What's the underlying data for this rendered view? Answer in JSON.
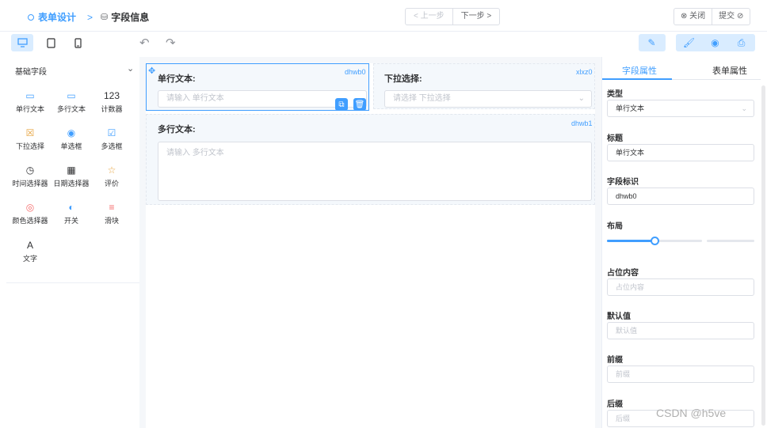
{
  "header": {
    "breadcrumb_1": "表单设计",
    "breadcrumb_sep": ">",
    "breadcrumb_2": "字段信息",
    "prev_label": "< 上一步",
    "next_label": "下一步 >",
    "close_label": "⊗ 关闭",
    "submit_label": "提交 ⊘"
  },
  "sidebar": {
    "title": "基础字段",
    "items": [
      {
        "label": "单行文本",
        "icon": "single-line-text-icon",
        "glyph": "▭"
      },
      {
        "label": "多行文本",
        "icon": "multi-line-text-icon",
        "glyph": "▭"
      },
      {
        "label": "计数器",
        "icon": "counter-icon",
        "glyph": "123"
      },
      {
        "label": "下拉选择",
        "icon": "select-icon",
        "glyph": "☒"
      },
      {
        "label": "单选框",
        "icon": "radio-icon",
        "glyph": "◉"
      },
      {
        "label": "多选框",
        "icon": "checkbox-icon",
        "glyph": "☑"
      },
      {
        "label": "时间选择器",
        "icon": "clock-icon",
        "glyph": "◷"
      },
      {
        "label": "日期选择器",
        "icon": "calendar-icon",
        "glyph": "▦"
      },
      {
        "label": "评价",
        "icon": "star-icon",
        "glyph": "☆"
      },
      {
        "label": "颜色选择器",
        "icon": "palette-icon",
        "glyph": "◎"
      },
      {
        "label": "开关",
        "icon": "switch-icon",
        "glyph": "◐"
      },
      {
        "label": "滑块",
        "icon": "slider-icon",
        "glyph": "≡"
      },
      {
        "label": "文字",
        "icon": "text-icon",
        "glyph": "A"
      }
    ]
  },
  "form": {
    "field1": {
      "label": "单行文本:",
      "id": "dhwb0",
      "placeholder": "请输入 单行文本"
    },
    "field2": {
      "label": "下拉选择:",
      "id": "xlxz0",
      "placeholder": "请选择 下拉选择"
    },
    "field3": {
      "label": "多行文本:",
      "id": "dhwb1",
      "placeholder": "请输入 多行文本"
    }
  },
  "props": {
    "tab_field": "字段属性",
    "tab_form": "表单属性",
    "type_label": "类型",
    "type_value": "单行文本",
    "title_label": "标题",
    "title_value": "单行文本",
    "key_label": "字段标识",
    "key_value": "dhwb0",
    "layout_label": "布局",
    "layout_slider_fraction": 0.5,
    "placeholder_label": "占位内容",
    "placeholder_ph": "占位内容",
    "default_label": "默认值",
    "default_ph": "默认值",
    "prefix_label": "前缀",
    "prefix_ph": "前缀",
    "suffix_label": "后缀",
    "suffix_ph": "后缀"
  },
  "colors": {
    "accent": "#409eff",
    "canvas_bg": "#f5f7fa"
  },
  "watermark": "CSDN @h5ve"
}
